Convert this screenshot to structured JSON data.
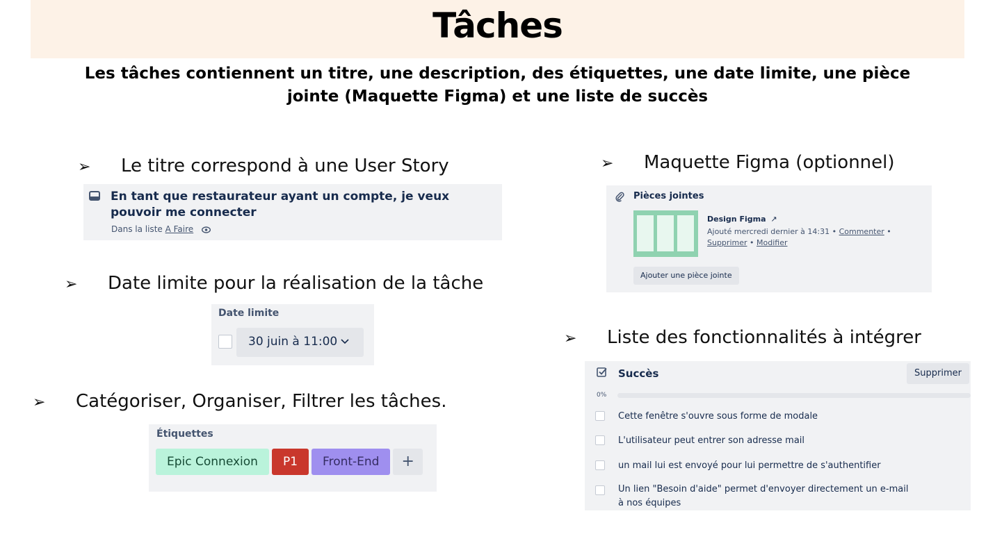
{
  "title": "Tâches",
  "subtitle": "Les tâches contiennent un titre, une description, des étiquettes, une date limite, une pièce jointe (Maquette Figma) et une liste de succès",
  "bullets": {
    "title_bullet": "Le titre correspond à une User Story",
    "date_bullet": "Date limite pour la réalisation de la tâche",
    "labels_bullet": "Catégoriser, Organiser, Filtrer les tâches.",
    "figma_bullet": "Maquette Figma (optionnel)",
    "checklist_bullet": "Liste des fonctionnalités à intégrer",
    "arrow": "➢"
  },
  "card_title": {
    "heading": "En tant que restaurateur ayant un compte, je veux pouvoir me connecter",
    "list_prefix": "Dans la liste",
    "list_name": "A Faire"
  },
  "due_date": {
    "label": "Date limite",
    "value": "30 juin à 11:00"
  },
  "labels": {
    "heading": "Étiquettes",
    "items": [
      {
        "text": "Epic Connexion",
        "bg": "#baf3db",
        "fg": "#164b35"
      },
      {
        "text": "P1",
        "bg": "#c9372c",
        "fg": "#ffffff"
      },
      {
        "text": "Front-End",
        "bg": "#9f8fef",
        "fg": "#352c63"
      }
    ],
    "add": "+"
  },
  "attachments": {
    "heading": "Pièces jointes",
    "name": "Design Figma",
    "name_arrow": "↗",
    "added": "Ajouté mercredi dernier à 14:31",
    "sep": "•",
    "comment": "Commenter",
    "delete": "Supprimer",
    "edit": "Modifier",
    "add_button": "Ajouter une pièce jointe",
    "thumb_color": "#8fd2b0"
  },
  "checklist": {
    "heading": "Succès",
    "delete_button": "Supprimer",
    "progress_label": "0%",
    "progress": 0,
    "items": [
      "Cette fenêtre s'ouvre sous forme de modale",
      "L'utilisateur peut entrer son adresse mail",
      "un mail lui est envoyé pour lui permettre de s'authentifier",
      "Un lien \"Besoin d'aide\" permet d'envoyer directement un e-mail à nos équipes"
    ]
  }
}
